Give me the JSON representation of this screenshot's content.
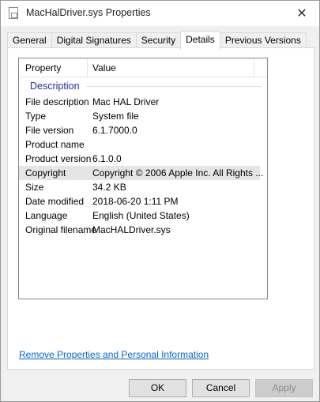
{
  "window": {
    "title": "MacHalDriver.sys Properties",
    "close_glyph": "✕"
  },
  "tabs": [
    {
      "label": "General"
    },
    {
      "label": "Digital Signatures"
    },
    {
      "label": "Security"
    },
    {
      "label": "Details",
      "active": true
    },
    {
      "label": "Previous Versions"
    }
  ],
  "details": {
    "columns": {
      "property": "Property",
      "value": "Value"
    },
    "group": "Description",
    "rows": [
      {
        "property": "File description",
        "value": "Mac HAL Driver"
      },
      {
        "property": "Type",
        "value": "System file"
      },
      {
        "property": "File version",
        "value": "6.1.7000.0"
      },
      {
        "property": "Product name",
        "value": ""
      },
      {
        "property": "Product version",
        "value": "6.1.0.0"
      },
      {
        "property": "Copyright",
        "value": "Copyright © 2006 Apple Inc. All Rights ...",
        "selected": true
      },
      {
        "property": "Size",
        "value": "34.2 KB"
      },
      {
        "property": "Date modified",
        "value": "2018-06-20 1:11 PM"
      },
      {
        "property": "Language",
        "value": "English (United States)"
      },
      {
        "property": "Original filename",
        "value": "MacHALDriver.sys"
      }
    ]
  },
  "link": {
    "label": "Remove Properties and Personal Information"
  },
  "buttons": {
    "ok": "OK",
    "cancel": "Cancel",
    "apply": "Apply"
  }
}
